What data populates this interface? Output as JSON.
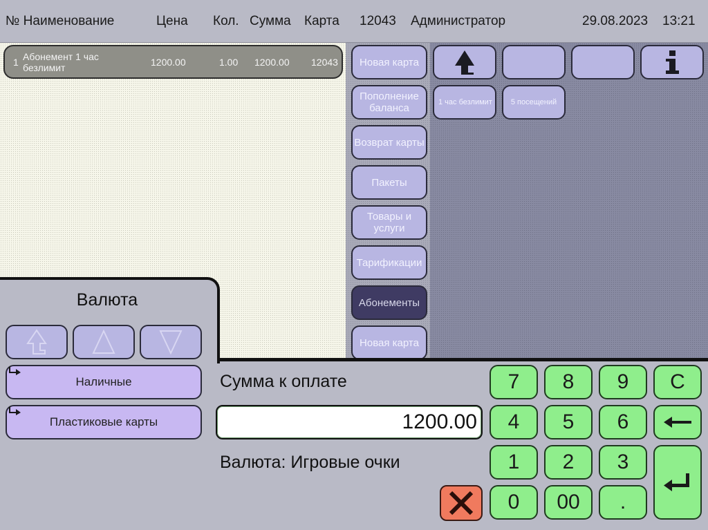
{
  "header": {
    "col_no_name": "№ Наименование",
    "col_price": "Цена",
    "col_qty": "Кол.",
    "col_sum": "Сумма",
    "col_card": "Карта",
    "card_number": "12043",
    "user": "Администратор",
    "date": "29.08.2023",
    "time": "13:21"
  },
  "receipt": {
    "items": [
      {
        "no": "1",
        "name_line1": "Абонемент 1 час",
        "name_line2": "безлимит",
        "price": "1200.00",
        "qty": "1.00",
        "sum": "1200.00",
        "card": "12043"
      }
    ]
  },
  "menu": {
    "items": [
      {
        "label": "Новая карта"
      },
      {
        "label": "Пополнение баланса"
      },
      {
        "label": "Возврат карты"
      },
      {
        "label": "Пакеты"
      },
      {
        "label": "Товары и услуги"
      },
      {
        "label": "Тарификации"
      },
      {
        "label": "Абонементы",
        "active": true
      },
      {
        "label": "Новая карта"
      }
    ]
  },
  "grid": {
    "tiles": [
      {
        "label": "1 час безлимит"
      },
      {
        "label": "5 посещений"
      }
    ],
    "icons": [
      "up-arrow-icon",
      "info-icon"
    ]
  },
  "currency": {
    "title": "Валюта",
    "options": [
      {
        "label": "Наличные"
      },
      {
        "label": "Пластиковые карты"
      }
    ]
  },
  "payment": {
    "amount_label": "Сумма к оплате",
    "amount_value": "1200.00",
    "currency_text": "Валюта: Игровые очки"
  },
  "keypad": {
    "keys": [
      "7",
      "8",
      "9",
      "C",
      "4",
      "5",
      "6",
      "1",
      "2",
      "3",
      "0",
      "00",
      "."
    ]
  },
  "colors": {
    "menu_button": "#b8b6e2",
    "menu_active": "#3f3b63",
    "pay_button": "#c8b8f2",
    "keypad": "#8fee8c",
    "cancel": "#f07a5e"
  }
}
